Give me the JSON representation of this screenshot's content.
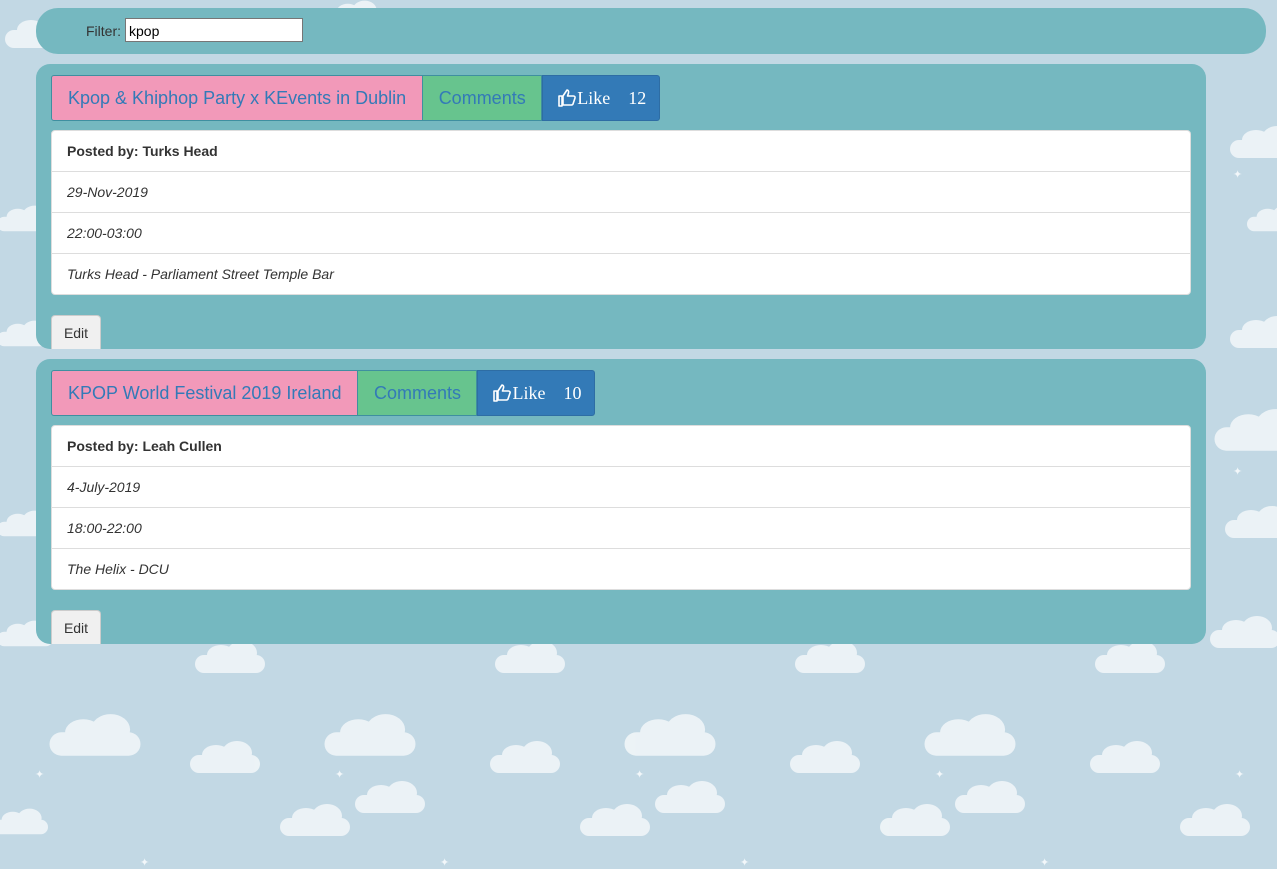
{
  "filter": {
    "label": "Filter:",
    "value": "kpop"
  },
  "events": [
    {
      "title": "Kpop & Khiphop Party x KEvents in Dublin",
      "comments_label": "Comments",
      "like_label": "Like",
      "like_count": "12",
      "posted_by_label": "Posted by:",
      "posted_by": "Turks Head",
      "date": "29-Nov-2019",
      "time": "22:00-03:00",
      "location": "Turks Head - Parliament Street Temple Bar",
      "edit_label": "Edit"
    },
    {
      "title": "KPOP World Festival 2019 Ireland",
      "comments_label": "Comments",
      "like_label": "Like",
      "like_count": "10",
      "posted_by_label": "Posted by:",
      "posted_by": "Leah Cullen",
      "date": "4-July-2019",
      "time": "18:00-22:00",
      "location": "The Helix - DCU",
      "edit_label": "Edit"
    }
  ],
  "colors": {
    "background": "#c2d8e4",
    "panel": "#75b8c0",
    "title_button": "#f299b9",
    "comments_button": "#67c48e",
    "like_button": "#337ab7",
    "link_text": "#337ab7"
  },
  "icons": {
    "like": "thumbs-up-icon"
  }
}
